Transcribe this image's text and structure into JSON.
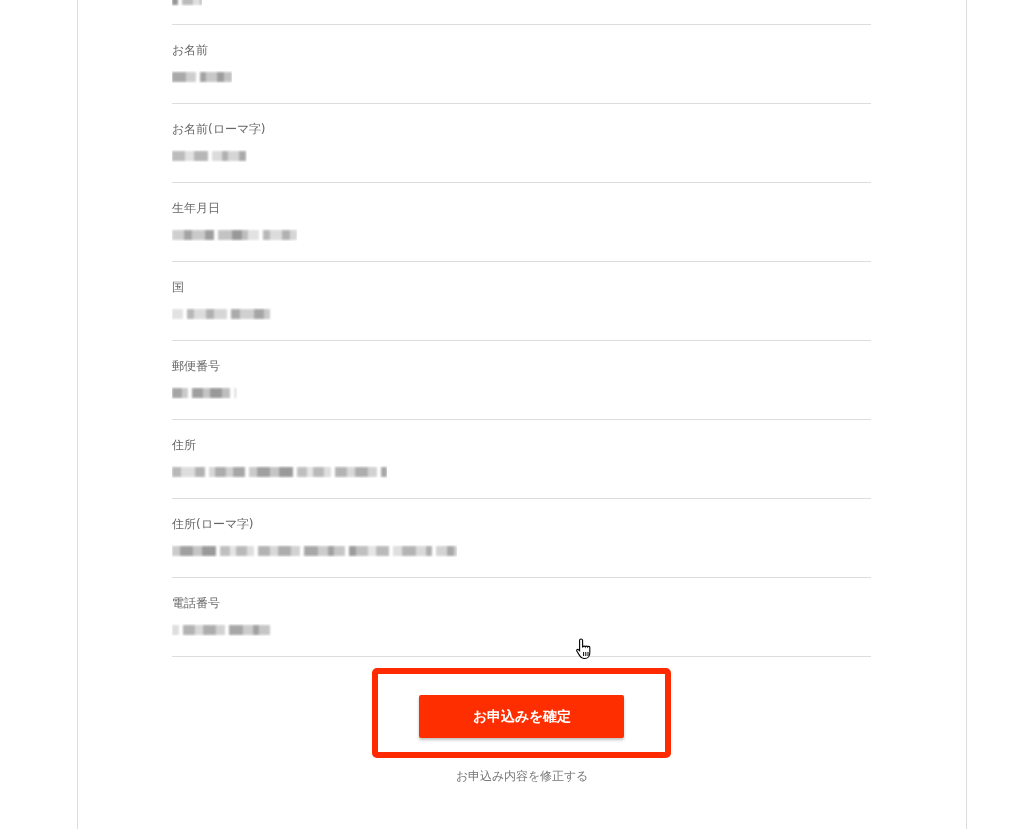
{
  "rows": [
    {
      "kind": "partial"
    },
    {
      "kind": "field",
      "label": "お名前"
    },
    {
      "kind": "field",
      "label": "お名前(ローマ字)"
    },
    {
      "kind": "field",
      "label": "生年月日"
    },
    {
      "kind": "field",
      "label": "国"
    },
    {
      "kind": "field",
      "label": "郵便番号"
    },
    {
      "kind": "field",
      "label": "住所"
    },
    {
      "kind": "field",
      "label": "住所(ローマ字)"
    },
    {
      "kind": "field",
      "label": "電話番号"
    }
  ],
  "confirm_button": {
    "label": "お申込みを確定",
    "highlighted": true
  },
  "edit_link": {
    "label": "お申込み内容を修正する"
  }
}
